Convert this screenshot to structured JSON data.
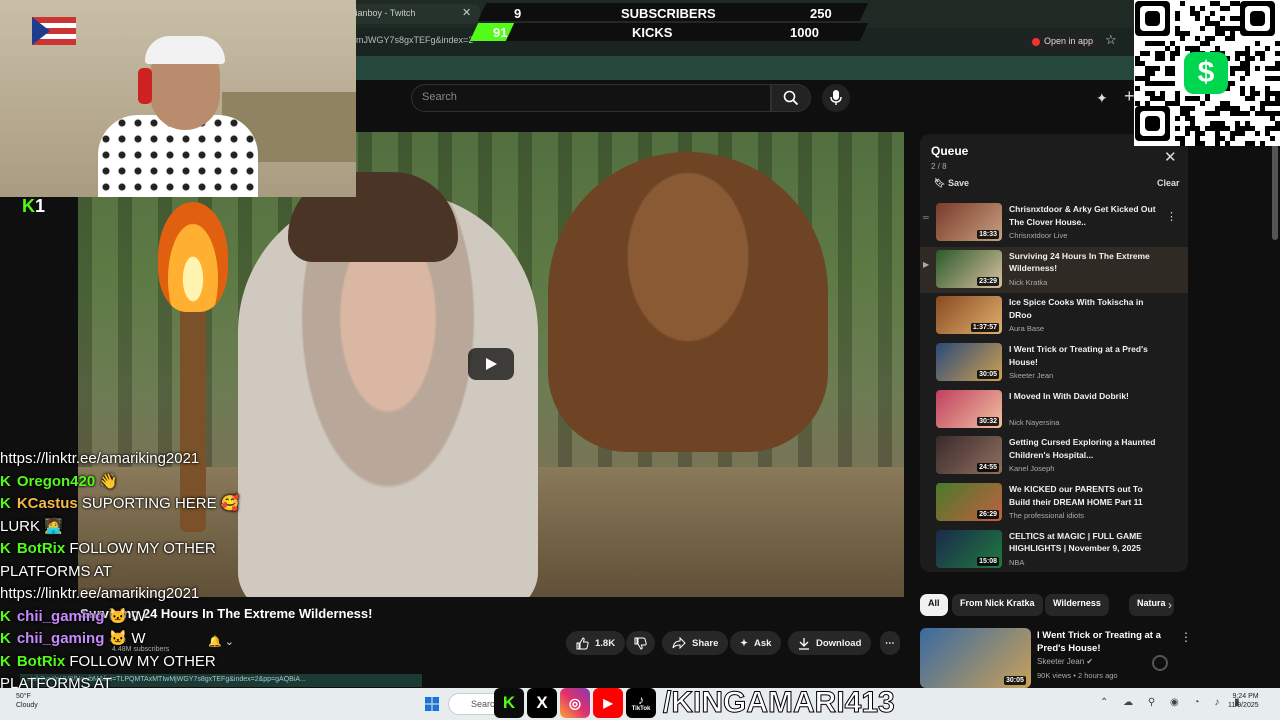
{
  "browser": {
    "tab_title": "asianboy - Twitch",
    "tab_close": "✕",
    "url_fragment": "mJWGY7s8gxTEFg&index=2",
    "open_in_app": "Open in app",
    "bookmark_icon": "star-icon"
  },
  "subs_overlay": {
    "row1_left": "9",
    "row1_label": "SUBSCRIBERS",
    "row1_right": "250",
    "row2_left": "91",
    "row2_label": "KICKS",
    "row2_right": "1000",
    "accent": "#53fc18"
  },
  "search": {
    "placeholder": "Search"
  },
  "kick_badge": {
    "count": "1"
  },
  "chat": [
    {
      "user": "",
      "text": "https://linktr.ee/amariking2021"
    },
    {
      "user": "Oregon420",
      "text": "👋"
    },
    {
      "user": "KCastus",
      "text": "SUPORTING HERE 🥰"
    },
    {
      "user": "",
      "text": "LURK 🧑‍💻"
    },
    {
      "user": "BotRix",
      "text": "FOLLOW MY OTHER"
    },
    {
      "user": "",
      "text": "PLATFORMS AT"
    },
    {
      "user": "",
      "text": "https://linktr.ee/amariking2021"
    },
    {
      "user": "chii_gaming",
      "text": "🐱 W"
    },
    {
      "user": "chii_gaming",
      "text": "🐱 W"
    },
    {
      "user": "BotRix",
      "text": "FOLLOW MY OTHER"
    },
    {
      "user": "",
      "text": "PLATFORMS AT"
    },
    {
      "user": "",
      "text": "https://linktr.ee/amariking2021"
    }
  ],
  "video": {
    "title": "Surviving 24 Hours In The Extreme Wilderness!",
    "subs": "4.48M subscribers",
    "likes": "1.8K",
    "share": "Share",
    "ask": "Ask",
    "download": "Download",
    "url_strip": "...tch?v=YeHV8/NowbM&list=TLPQMTAxMTIwMjWGY7s8gxTEFg&index=2&pp=gAQBiA..."
  },
  "queue": {
    "title": "Queue",
    "count": "2 / 8",
    "save": "Save",
    "clear": "Clear",
    "items": [
      {
        "title": "Chrisnxtdoor & Arky Get Kicked Out The Clover House..",
        "channel": "Chrisnxtdoor Live",
        "duration": "18:33",
        "active": false
      },
      {
        "title": "Surviving 24 Hours In The Extreme Wilderness!",
        "channel": "Nick Kratka",
        "duration": "23:29",
        "active": true
      },
      {
        "title": "Ice Spice Cooks With Tokischa in DRoo",
        "channel": "Aura Base",
        "duration": "1:37:57",
        "active": false
      },
      {
        "title": "I Went Trick or Treating at a Pred's House!",
        "channel": "Skeeter Jean",
        "duration": "30:05",
        "active": false
      },
      {
        "title": "I Moved In With David Dobrik!",
        "channel": "Nick Nayersina",
        "duration": "30:32",
        "active": false
      },
      {
        "title": "Getting Cursed Exploring a Haunted Children's Hospital...",
        "channel": "Kanel Joseph",
        "duration": "24:55",
        "active": false
      },
      {
        "title": "We KICKED our PARENTS out To Build their DREAM HOME Part 11",
        "channel": "The professional idiots",
        "duration": "26:29",
        "active": false
      },
      {
        "title": "CELTICS at MAGIC | FULL GAME HIGHLIGHTS | November 9, 2025",
        "channel": "NBA",
        "duration": "15:08",
        "active": false
      }
    ]
  },
  "chips": [
    "All",
    "From Nick Kratka",
    "Wilderness",
    "Natura"
  ],
  "recommendation": {
    "title": "I Went Trick or Treating at a Pred's House!",
    "channel": "Skeeter Jean",
    "meta": "90K views • 2 hours ago",
    "duration": "30:05"
  },
  "taskbar": {
    "weather_temp": "50°F",
    "weather_desc": "Cloudy",
    "search_label": "Search",
    "time": "9:24 PM",
    "date": "11/9/2025"
  },
  "socials": {
    "handle": "/KINGAMARI413",
    "icons": [
      "kick-icon",
      "x-icon",
      "instagram-icon",
      "youtube-icon",
      "tiktok-icon"
    ],
    "tiktok_label": "TikTok"
  },
  "qr": {
    "cash_symbol": "$"
  }
}
